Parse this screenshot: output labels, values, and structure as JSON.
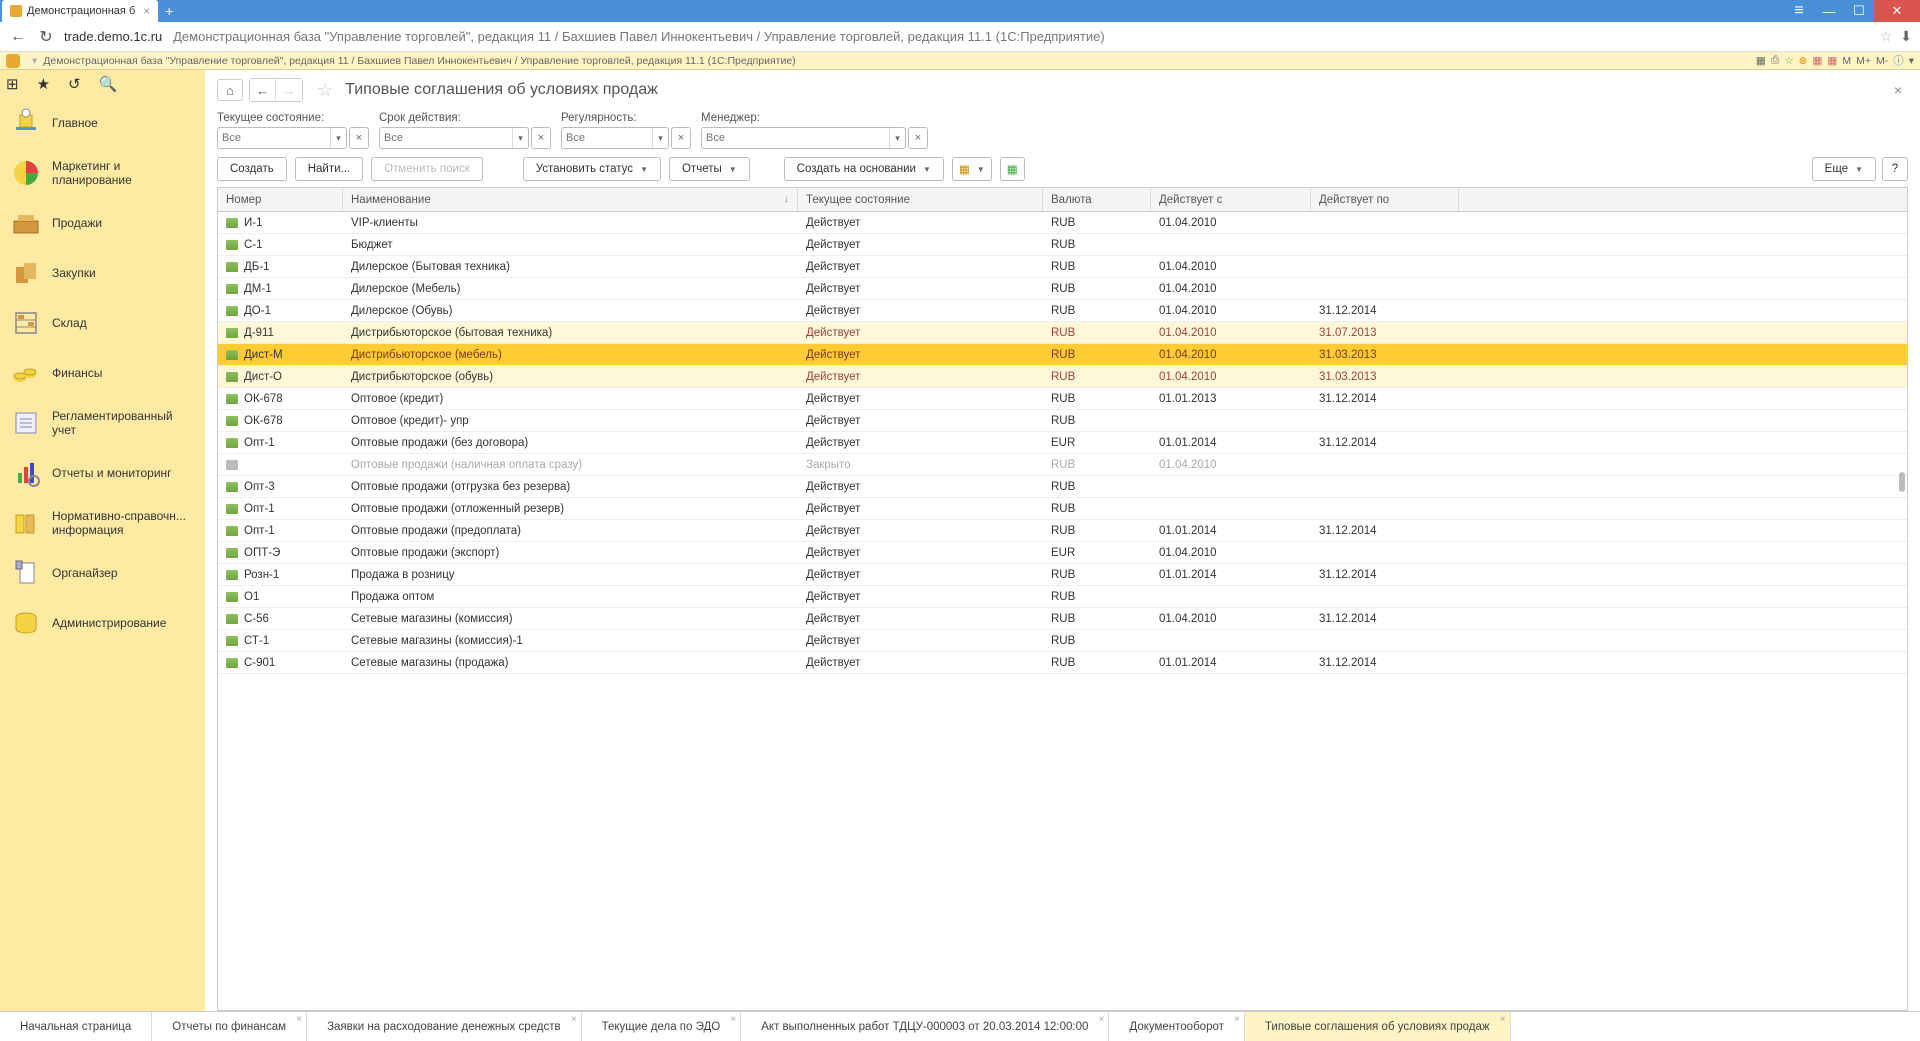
{
  "browser": {
    "tab_title": "Демонстрационная б",
    "url_domain": "trade.demo.1c.ru",
    "url_path": "Демонстрационная база \"Управление торговлей\", редакция 11 / Бахшиев Павел Иннокентьевич / Управление торговлей, редакция 11.1 (1С:Предприятие)"
  },
  "app_bar": {
    "title": "Демонстрационная база \"Управление торговлей\", редакция 11 / Бахшиев Павел Иннокентьевич / Управление торговлей, редакция 11.1  (1С:Предприятие)",
    "right_labels": [
      "M",
      "M+",
      "M-"
    ]
  },
  "sidebar": {
    "items": [
      {
        "label": "Главное"
      },
      {
        "label": "Маркетинг и планирование"
      },
      {
        "label": "Продажи"
      },
      {
        "label": "Закупки"
      },
      {
        "label": "Склад"
      },
      {
        "label": "Финансы"
      },
      {
        "label": "Регламентированный учет"
      },
      {
        "label": "Отчеты и мониторинг"
      },
      {
        "label": "Нормативно-справочн... информация"
      },
      {
        "label": "Органайзер"
      },
      {
        "label": "Администрирование"
      }
    ]
  },
  "page": {
    "title": "Типовые соглашения об условиях продаж"
  },
  "filters": {
    "f0": {
      "label": "Текущее состояние:",
      "placeholder": "Все"
    },
    "f1": {
      "label": "Срок действия:",
      "placeholder": "Все"
    },
    "f2": {
      "label": "Регулярность:",
      "placeholder": "Все"
    },
    "f3": {
      "label": "Менеджер:",
      "placeholder": "Все"
    }
  },
  "toolbar": {
    "create": "Создать",
    "find": "Найти...",
    "cancel_find": "Отменить поиск",
    "set_status": "Установить статус",
    "reports": "Отчеты",
    "create_based": "Создать на основании",
    "more": "Еще",
    "help": "?"
  },
  "table": {
    "columns": [
      "Номер",
      "Наименование",
      "Текущее состояние",
      "Валюта",
      "Действует с",
      "Действует по"
    ],
    "rows": [
      {
        "num": "И-1",
        "name": "VIP-клиенты",
        "state": "Действует",
        "cur": "RUB",
        "from": "01.04.2010",
        "to": "",
        "cls": ""
      },
      {
        "num": "С-1",
        "name": "Бюджет",
        "state": "Действует",
        "cur": "RUB",
        "from": "",
        "to": "",
        "cls": ""
      },
      {
        "num": "ДБ-1",
        "name": "Дилерское (Бытовая техника)",
        "state": "Действует",
        "cur": "RUB",
        "from": "01.04.2010",
        "to": "",
        "cls": ""
      },
      {
        "num": "ДМ-1",
        "name": "Дилерское (Мебель)",
        "state": "Действует",
        "cur": "RUB",
        "from": "01.04.2010",
        "to": "",
        "cls": ""
      },
      {
        "num": "ДО-1",
        "name": "Дилерское (Обувь)",
        "state": "Действует",
        "cur": "RUB",
        "from": "01.04.2010",
        "to": "31.12.2014",
        "cls": ""
      },
      {
        "num": "Д-911",
        "name": "Дистрибьюторское (бытовая техника)",
        "state": "Действует",
        "cur": "RUB",
        "from": "01.04.2010",
        "to": "31.07.2013",
        "cls": "hl-yellow"
      },
      {
        "num": "Дист-М",
        "name": "Дистрибьюторское (мебель)",
        "state": "Действует",
        "cur": "RUB",
        "from": "01.04.2010",
        "to": "31.03.2013",
        "cls": "hl-selected"
      },
      {
        "num": "Дист-О",
        "name": "Дистрибьюторское (обувь)",
        "state": "Действует",
        "cur": "RUB",
        "from": "01.04.2010",
        "to": "31.03.2013",
        "cls": "hl-yellow"
      },
      {
        "num": "ОК-678",
        "name": "Оптовое (кредит)",
        "state": "Действует",
        "cur": "RUB",
        "from": "01.01.2013",
        "to": "31.12.2014",
        "cls": ""
      },
      {
        "num": "ОК-678",
        "name": "Оптовое (кредит)- упр",
        "state": "Действует",
        "cur": "RUB",
        "from": "",
        "to": "",
        "cls": ""
      },
      {
        "num": "Опт-1",
        "name": "Оптовые продажи (без договора)",
        "state": "Действует",
        "cur": "EUR",
        "from": "01.01.2014",
        "to": "31.12.2014",
        "cls": ""
      },
      {
        "num": "",
        "name": "Оптовые продажи (наличная оплата сразу)",
        "state": "Закрыто",
        "cur": "RUB",
        "from": "01.04.2010",
        "to": "",
        "cls": "closed"
      },
      {
        "num": "Опт-3",
        "name": "Оптовые продажи (отгрузка без резерва)",
        "state": "Действует",
        "cur": "RUB",
        "from": "",
        "to": "",
        "cls": ""
      },
      {
        "num": "Опт-1",
        "name": "Оптовые продажи (отложенный резерв)",
        "state": "Действует",
        "cur": "RUB",
        "from": "",
        "to": "",
        "cls": ""
      },
      {
        "num": "Опт-1",
        "name": "Оптовые продажи (предоплата)",
        "state": "Действует",
        "cur": "RUB",
        "from": "01.01.2014",
        "to": "31.12.2014",
        "cls": ""
      },
      {
        "num": "ОПТ-Э",
        "name": "Оптовые продажи (экспорт)",
        "state": "Действует",
        "cur": "EUR",
        "from": "01.04.2010",
        "to": "",
        "cls": ""
      },
      {
        "num": "Розн-1",
        "name": "Продажа в розницу",
        "state": "Действует",
        "cur": "RUB",
        "from": "01.01.2014",
        "to": "31.12.2014",
        "cls": ""
      },
      {
        "num": "О1",
        "name": "Продажа оптом",
        "state": "Действует",
        "cur": "RUB",
        "from": "",
        "to": "",
        "cls": ""
      },
      {
        "num": "С-56",
        "name": "Сетевые магазины (комиссия)",
        "state": "Действует",
        "cur": "RUB",
        "from": "01.04.2010",
        "to": "31.12.2014",
        "cls": ""
      },
      {
        "num": "СТ-1",
        "name": "Сетевые магазины (комиссия)-1",
        "state": "Действует",
        "cur": "RUB",
        "from": "",
        "to": "",
        "cls": ""
      },
      {
        "num": "С-901",
        "name": "Сетевые магазины (продажа)",
        "state": "Действует",
        "cur": "RUB",
        "from": "01.01.2014",
        "to": "31.12.2014",
        "cls": ""
      }
    ]
  },
  "bottom_tabs": [
    {
      "label": "Начальная страница",
      "active": false,
      "closable": false
    },
    {
      "label": "Отчеты по финансам",
      "active": false,
      "closable": true
    },
    {
      "label": "Заявки на расходование денежных средств",
      "active": false,
      "closable": true
    },
    {
      "label": "Текущие дела по ЭДО",
      "active": false,
      "closable": true
    },
    {
      "label": "Акт выполненных работ ТДЦУ-000003 от 20.03.2014 12:00:00",
      "active": false,
      "closable": true
    },
    {
      "label": "Документооборот",
      "active": false,
      "closable": true
    },
    {
      "label": "Типовые соглашения об условиях продаж",
      "active": true,
      "closable": true
    }
  ]
}
